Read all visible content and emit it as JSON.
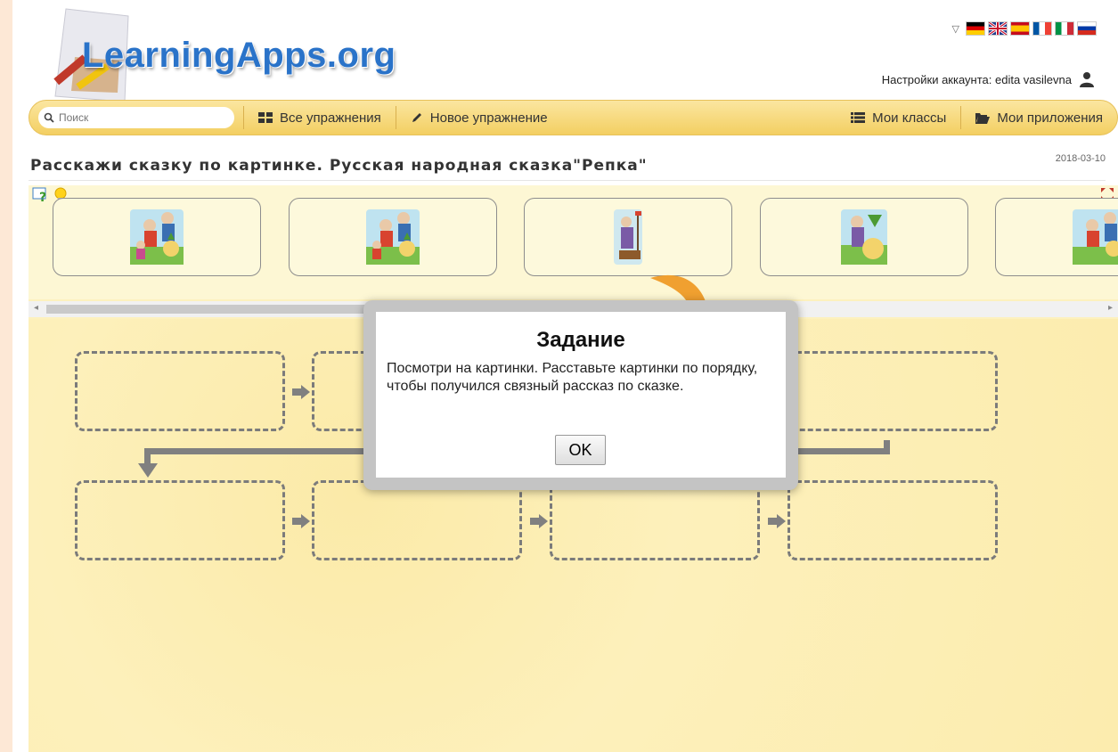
{
  "header": {
    "logo_text": "LearningApps.org",
    "account_label": "Настройки аккаунта: edita vasilevna",
    "languages": [
      "de",
      "en",
      "es",
      "fr",
      "it",
      "ru"
    ]
  },
  "nav": {
    "search_placeholder": "Поиск",
    "all_exercises": "Все упражнения",
    "new_exercise": "Новое упражнение",
    "my_classes": "Мои классы",
    "my_apps": "Мои приложения"
  },
  "exercise": {
    "title": "Расскажи сказку по картинке. Русская народная сказка\"Репка\"",
    "date": "2018-03-10"
  },
  "cards": [
    {
      "image": "family-pulling-turnip"
    },
    {
      "image": "family-pulling-turnip"
    },
    {
      "image": "grandfather-planting"
    },
    {
      "image": "grandfather-with-turnip"
    },
    {
      "image": "family-pulling-turnip"
    }
  ],
  "dialog": {
    "title": "Задание",
    "text": "Посмотри на картинки. Расставьте картинки по порядку, чтобы получился связный рассказ по сказке.",
    "ok_label": "OK"
  },
  "colors": {
    "nav_bg": "#f3cf62",
    "app_bg": "#fdf1be",
    "logo_blue": "#2a73c9",
    "page_border": "#fde8d6"
  }
}
